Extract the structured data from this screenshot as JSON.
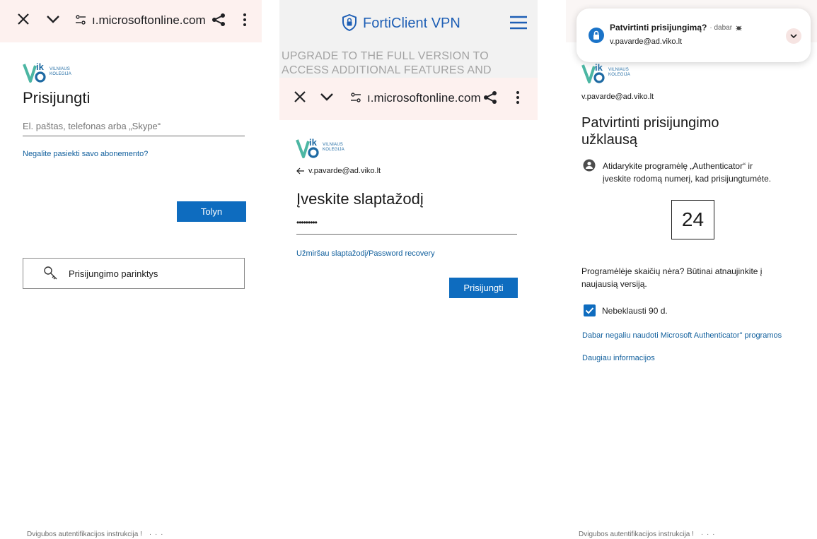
{
  "browser": {
    "url": "ı.microsoftonline.com"
  },
  "logo": {
    "line1": "VILNIAUS",
    "line2": "KOLEGIJA"
  },
  "screen1": {
    "title": "Prisijungti",
    "email_placeholder": "El. paštas, telefonas arba „Skype“",
    "link_subscription": "Negalite pasiekti savo abonemento?",
    "next_button": "Tolyn",
    "signin_options": "Prisijungimo parinktys",
    "footer_link": "Dvigubos autentifikacijos instrukcija !",
    "footer_more": "· · ·"
  },
  "screen2": {
    "vpn_title": "FortiClient VPN",
    "upgrade_banner": "UPGRADE TO THE FULL VERSION TO ACCESS ADDITIONAL FEATURES AND",
    "back_email": "v.pavarde@ad.viko.lt",
    "title": "Įveskite slaptažodį",
    "password_value": "•••••••••",
    "forgot_link": "Užmiršau slaptažodį/Password recovery",
    "signin_button": "Prisijungti"
  },
  "screen3": {
    "notification": {
      "title": "Patvirtinti prisijungimą?",
      "meta": "· dabar",
      "email": "v.pavarde@ad.viko.lt"
    },
    "email": "v.pavarde@ad.viko.lt",
    "title_line1": "Patvirtinti prisijungimo",
    "title_line2": "užklausą",
    "instruction_line1": "Atidarykite programėlę „Authenticator“ ir",
    "instruction_line2": "įveskite rodomą numerį, kad prisijungtumėte.",
    "number": "24",
    "no_numbers_line1": "Programėlėje skaičių nėra? Būtinai atnaujinkite į",
    "no_numbers_line2": "naujausią versiją.",
    "dont_ask_label": "Nebeklausti 90 d.",
    "cant_use_link": "Dabar negaliu naudoti Microsoft Authenticator\" programos",
    "more_info_link": "Daugiau informacijos",
    "footer_link": "Dvigubos autentifikacijos instrukcija !",
    "footer_more": "· · ·"
  }
}
